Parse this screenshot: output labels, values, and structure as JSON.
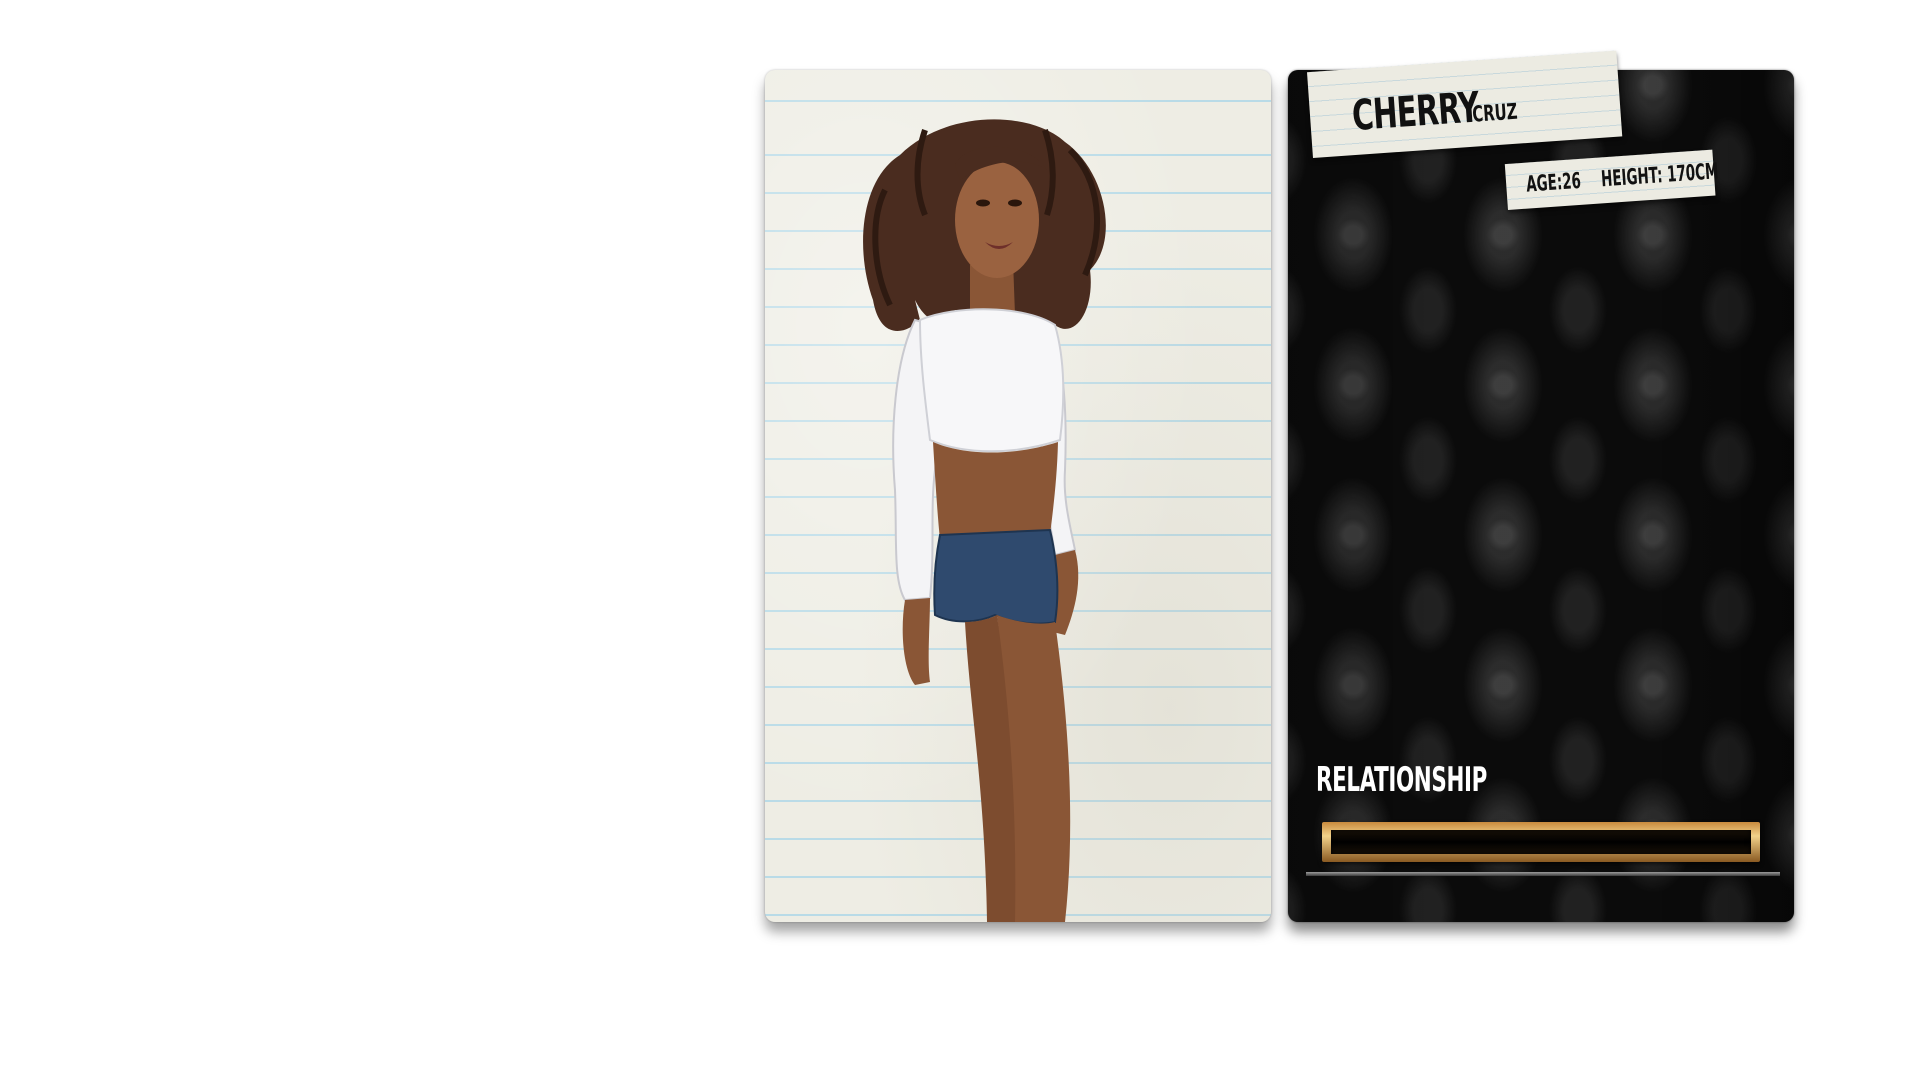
{
  "character": {
    "first_name": "CHERRY",
    "last_name": "CRUZ",
    "age_text": "AGE:26",
    "height_text": "HEIGHT: 170CM"
  },
  "relationship": {
    "label": "RELATIONSHIP",
    "progress_fraction": 0.0
  },
  "colors": {
    "bar_frame_gold": "#d9a657",
    "card_dark": "#0b0b0b",
    "notebook_paper": "#eeede4",
    "notebook_lines": "#b9dbe7"
  },
  "icons": {
    "portrait": "character-portrait-illustration"
  }
}
